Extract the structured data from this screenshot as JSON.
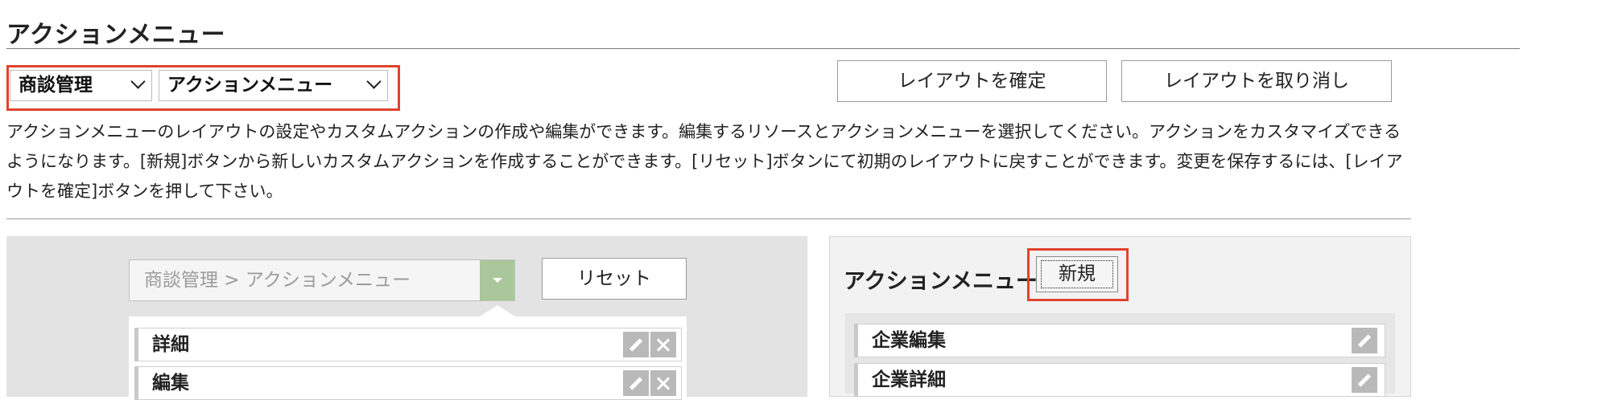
{
  "page": {
    "title": "アクションメニュー",
    "description": "アクションメニューのレイアウトの設定やカスタムアクションの作成や編集ができます。編集するリソースとアクションメニューを選択してください。アクションをカスタマイズできるようになります。[新規]ボタンから新しいカスタムアクションを作成することができます。[リセット]ボタンにて初期のレイアウトに戻すことができます。変更を保存するには、[レイアウトを確定]ボタンを押して下さい。"
  },
  "selectors": {
    "resource": "商談管理",
    "menu": "アクションメニュー"
  },
  "toolbar": {
    "confirm_label": "レイアウトを確定",
    "cancel_label": "レイアウトを取り消し"
  },
  "left_panel": {
    "resource_path": "商談管理 > アクションメニュー",
    "reset_label": "リセット",
    "items": [
      {
        "label": "詳細"
      },
      {
        "label": "編集"
      }
    ]
  },
  "right_panel": {
    "title": "アクションメニュー",
    "new_label": "新規",
    "items": [
      {
        "label": "企業編集"
      },
      {
        "label": "企業詳細"
      }
    ]
  },
  "colors": {
    "highlight": "#e0432c",
    "dropdown_accent": "#a9c79a",
    "icon_bg": "#b9b9b9"
  },
  "icons": [
    "chevron-down-icon",
    "triangle-down-icon",
    "pencil-icon",
    "close-icon"
  ]
}
